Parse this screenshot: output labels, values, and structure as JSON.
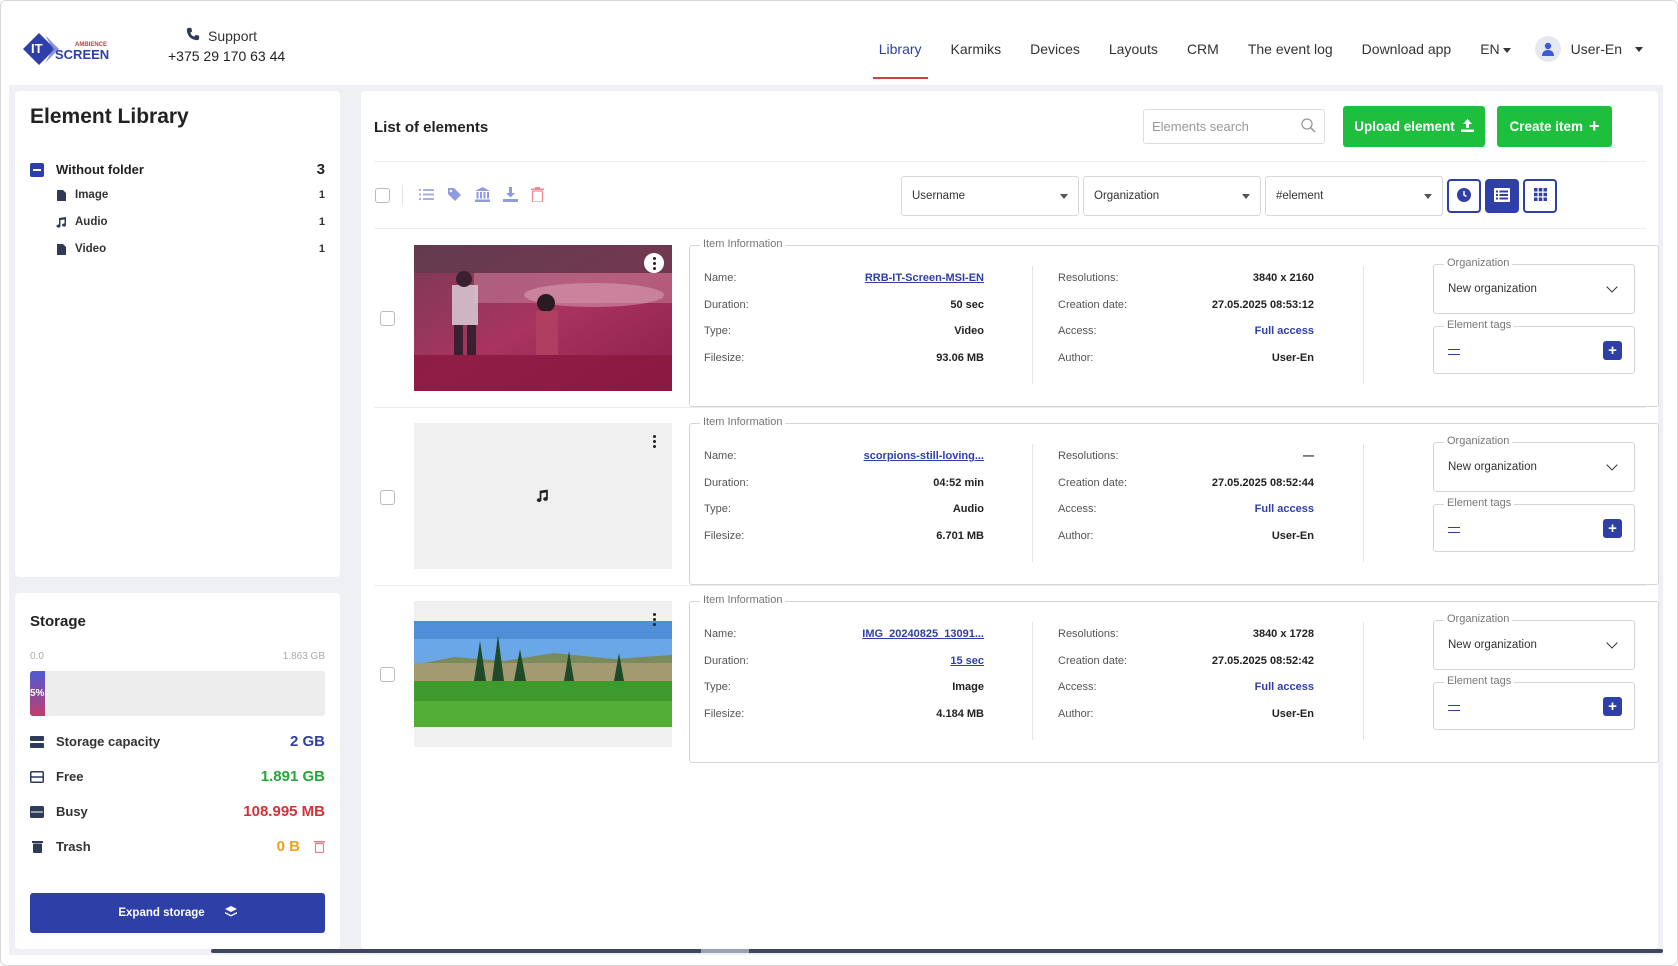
{
  "header": {
    "logo_text": "IT SCREEN",
    "logo_tagline": "AMBIENCE",
    "support_label": "Support",
    "support_phone": "+375 29 170 63 44",
    "nav": [
      {
        "label": "Library",
        "active": true
      },
      {
        "label": "Karmiks"
      },
      {
        "label": "Devices"
      },
      {
        "label": "Layouts"
      },
      {
        "label": "CRM"
      },
      {
        "label": "The event log"
      },
      {
        "label": "Download app"
      }
    ],
    "lang": "EN",
    "user": "User-En"
  },
  "library": {
    "title": "Element Library",
    "folder": {
      "name": "Without folder",
      "count": "3"
    },
    "items": [
      {
        "name": "Image",
        "count": "1",
        "icon": "file-icon"
      },
      {
        "name": "Audio",
        "count": "1",
        "icon": "music-icon"
      },
      {
        "name": "Video",
        "count": "1",
        "icon": "file-icon"
      }
    ]
  },
  "storage": {
    "title": "Storage",
    "scale_min": "0.0",
    "scale_max": "1.863 GB",
    "used_percent": 5,
    "used_label": "5%",
    "rows": [
      {
        "label": "Storage capacity",
        "value": "2 GB",
        "color": "#2e3fa8"
      },
      {
        "label": "Free",
        "value": "1.891 GB",
        "color": "#22a83a"
      },
      {
        "label": "Busy",
        "value": "108.995 MB",
        "color": "#d0323a"
      },
      {
        "label": "Trash",
        "value": "0 B",
        "color": "#f0a020"
      }
    ],
    "expand_label": "Expand storage"
  },
  "main": {
    "title": "List of elements",
    "search_placeholder": "Elements search",
    "upload_label": "Upload element",
    "create_label": "Create item",
    "filters": {
      "username": "Username",
      "organization": "Organization",
      "element": "#element"
    }
  },
  "elements": [
    {
      "thumb": "video",
      "info_title": "Item Information",
      "name": "RRB-IT-Screen-MSI-EN",
      "duration": "50 sec",
      "type": "Video",
      "filesize": "93.06 MB",
      "resolution": "3840 x 2160",
      "creation_date": "27.05.2025 08:53:12",
      "access": "Full access",
      "author": "User-En",
      "organization_label": "Organization",
      "organization": "New organization",
      "tags_label": "Element tags"
    },
    {
      "thumb": "audio",
      "info_title": "Item Information",
      "name": "scorpions-still-loving...",
      "duration": "04:52 min",
      "type": "Audio",
      "filesize": "6.701 MB",
      "resolution": "—",
      "creation_date": "27.05.2025 08:52:44",
      "access": "Full access",
      "author": "User-En",
      "organization_label": "Organization",
      "organization": "New organization",
      "tags_label": "Element tags"
    },
    {
      "thumb": "image",
      "info_title": "Item Information",
      "name": "IMG_20240825_13091...",
      "duration": "15 sec",
      "type": "Image",
      "filesize": "4.184 MB",
      "resolution": "3840 x 1728",
      "creation_date": "27.05.2025 08:52:42",
      "access": "Full access",
      "author": "User-En",
      "organization_label": "Organization",
      "organization": "New organization",
      "tags_label": "Element tags"
    }
  ],
  "labels": {
    "name": "Name:",
    "duration": "Duration:",
    "type": "Type:",
    "filesize": "Filesize:",
    "resolution": "Resolutions:",
    "creation_date": "Creation date:",
    "access": "Access:",
    "author": "Author:"
  }
}
